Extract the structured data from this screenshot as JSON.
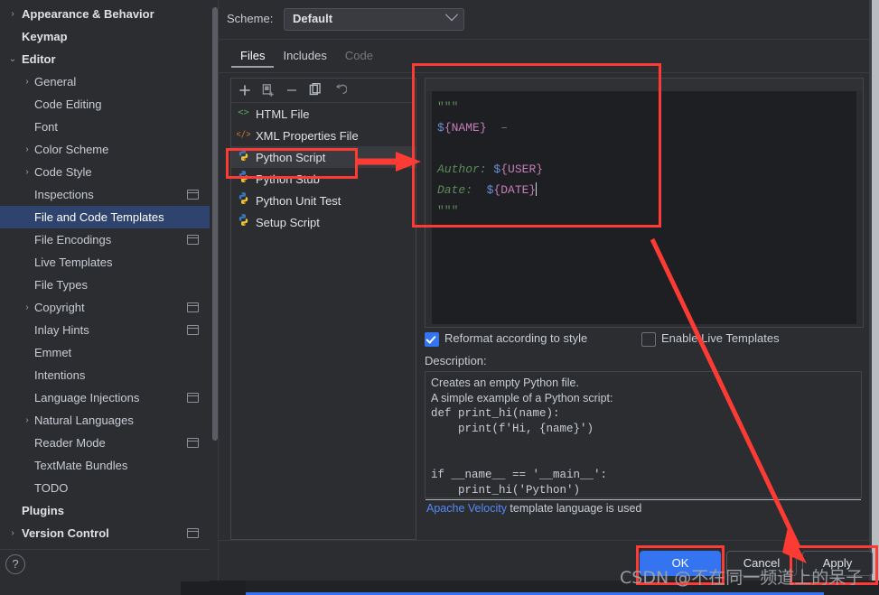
{
  "sidebar": {
    "items": [
      {
        "label": "Appearance & Behavior",
        "level": 0,
        "arrow": "›",
        "selected": false,
        "badge": false
      },
      {
        "label": "Keymap",
        "level": 0,
        "arrow": "",
        "selected": false,
        "badge": false
      },
      {
        "label": "Editor",
        "level": 0,
        "arrow": "⌄",
        "selected": false,
        "badge": false
      },
      {
        "label": "General",
        "level": 1,
        "arrow": "›",
        "selected": false,
        "badge": false
      },
      {
        "label": "Code Editing",
        "level": 1,
        "arrow": "",
        "selected": false,
        "badge": false
      },
      {
        "label": "Font",
        "level": 1,
        "arrow": "",
        "selected": false,
        "badge": false
      },
      {
        "label": "Color Scheme",
        "level": 1,
        "arrow": "›",
        "selected": false,
        "badge": false
      },
      {
        "label": "Code Style",
        "level": 1,
        "arrow": "›",
        "selected": false,
        "badge": false
      },
      {
        "label": "Inspections",
        "level": 1,
        "arrow": "",
        "selected": false,
        "badge": true
      },
      {
        "label": "File and Code Templates",
        "level": 1,
        "arrow": "",
        "selected": true,
        "badge": false
      },
      {
        "label": "File Encodings",
        "level": 1,
        "arrow": "",
        "selected": false,
        "badge": true
      },
      {
        "label": "Live Templates",
        "level": 1,
        "arrow": "",
        "selected": false,
        "badge": false
      },
      {
        "label": "File Types",
        "level": 1,
        "arrow": "",
        "selected": false,
        "badge": false
      },
      {
        "label": "Copyright",
        "level": 1,
        "arrow": "›",
        "selected": false,
        "badge": true
      },
      {
        "label": "Inlay Hints",
        "level": 1,
        "arrow": "",
        "selected": false,
        "badge": true
      },
      {
        "label": "Emmet",
        "level": 1,
        "arrow": "",
        "selected": false,
        "badge": false
      },
      {
        "label": "Intentions",
        "level": 1,
        "arrow": "",
        "selected": false,
        "badge": false
      },
      {
        "label": "Language Injections",
        "level": 1,
        "arrow": "",
        "selected": false,
        "badge": true
      },
      {
        "label": "Natural Languages",
        "level": 1,
        "arrow": "›",
        "selected": false,
        "badge": false
      },
      {
        "label": "Reader Mode",
        "level": 1,
        "arrow": "",
        "selected": false,
        "badge": true
      },
      {
        "label": "TextMate Bundles",
        "level": 1,
        "arrow": "",
        "selected": false,
        "badge": false
      },
      {
        "label": "TODO",
        "level": 1,
        "arrow": "",
        "selected": false,
        "badge": false
      },
      {
        "label": "Plugins",
        "level": 0,
        "arrow": "",
        "selected": false,
        "badge": false
      },
      {
        "label": "Version Control",
        "level": 0,
        "arrow": "›",
        "selected": false,
        "badge": true
      }
    ],
    "help_label": "?"
  },
  "scheme": {
    "label": "Scheme:",
    "value": "Default"
  },
  "tabs": [
    {
      "label": "Files",
      "state": "active"
    },
    {
      "label": "Includes",
      "state": "normal"
    },
    {
      "label": "Code",
      "state": "disabled"
    }
  ],
  "toolbar": {
    "icons": [
      {
        "name": "add-icon",
        "title": "Add"
      },
      {
        "name": "create-child-template-icon",
        "title": "Create Child Template File"
      },
      {
        "name": "remove-icon",
        "title": "Remove"
      },
      {
        "name": "copy-icon",
        "title": "Copy"
      },
      {
        "name": "reset-icon",
        "title": "Reset to Default"
      }
    ]
  },
  "file_list": [
    {
      "label": "HTML File",
      "icon": "html-file-icon",
      "selected": false
    },
    {
      "label": "XML Properties File",
      "icon": "xml-properties-file-icon",
      "selected": false
    },
    {
      "label": "Python Script",
      "icon": "python-file-icon",
      "selected": true
    },
    {
      "label": "Python Stub",
      "icon": "python-file-icon",
      "selected": false
    },
    {
      "label": "Python Unit Test",
      "icon": "python-file-icon",
      "selected": false
    },
    {
      "label": "Setup Script",
      "icon": "python-file-icon",
      "selected": false
    }
  ],
  "editor": {
    "lines": [
      [
        {
          "t": "\"\"\"",
          "c": "c-str"
        }
      ],
      [
        {
          "t": "$",
          "c": "c-dollar"
        },
        {
          "t": "{NAME}",
          "c": "c-var"
        },
        {
          "t": "  –",
          "c": "c-dash"
        }
      ],
      [
        {
          "t": "",
          "c": "c-com"
        }
      ],
      [
        {
          "t": "Author: ",
          "c": "c-com"
        },
        {
          "t": "$",
          "c": "c-dollar"
        },
        {
          "t": "{USER}",
          "c": "c-var"
        }
      ],
      [
        {
          "t": "Date:  ",
          "c": "c-com"
        },
        {
          "t": "$",
          "c": "c-dollar"
        },
        {
          "t": "{DATE}",
          "c": "c-var"
        },
        {
          "t": "|caret|",
          "c": "caret"
        }
      ],
      [
        {
          "t": "\"\"\"",
          "c": "c-str"
        }
      ]
    ]
  },
  "options": {
    "reformat": {
      "label": "Reformat according to style",
      "checked": true
    },
    "live_templates": {
      "label": "Enable Live Templates",
      "checked": false
    }
  },
  "description": {
    "label": "Description:",
    "lines": [
      {
        "text": "Creates an empty Python file.",
        "mono": false
      },
      {
        "text": "A simple example of a Python script:",
        "mono": false
      },
      {
        "text": "def print_hi(name):",
        "mono": true
      },
      {
        "text": "    print(f'Hi, {name}')",
        "mono": true
      },
      {
        "text": "",
        "mono": true
      },
      {
        "text": "",
        "mono": true
      },
      {
        "text": "if __name__ == '__main__':",
        "mono": true
      },
      {
        "text": "    print_hi('Python')",
        "mono": true
      }
    ],
    "footer_link": "Apache Velocity",
    "footer_rest": " template language is used"
  },
  "buttons": {
    "ok": "OK",
    "cancel": "Cancel",
    "apply": "Apply"
  },
  "watermark": "CSDN @不在同一频道上的呆子",
  "annotation_color": "#fd3b35",
  "colors": {
    "accent": "#3574f0",
    "selection": "#2e436e",
    "panel_bg": "#2b2d30",
    "editor_bg": "#1e1f22",
    "link": "#548af7"
  }
}
